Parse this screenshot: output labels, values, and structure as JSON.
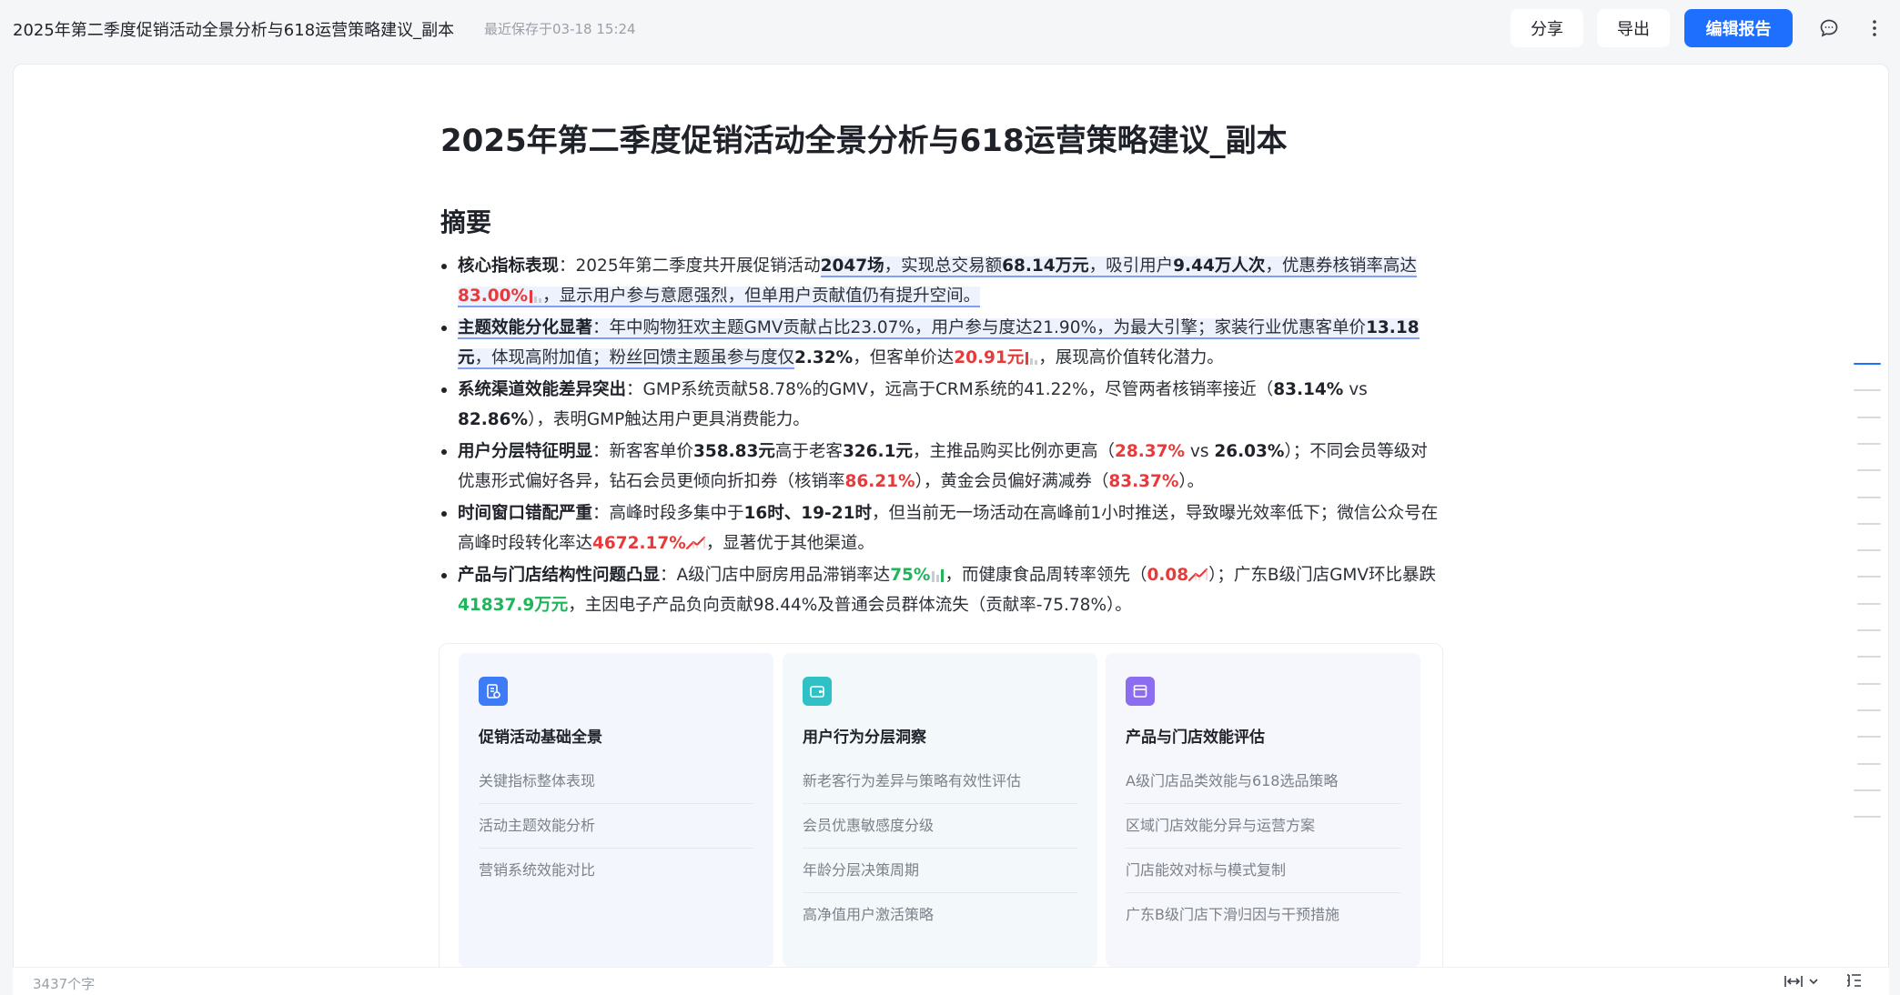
{
  "header": {
    "doc_title": "2025年第二季度促销活动全景分析与618运营策略建议_副本",
    "save_time": "最近保存于03-18 15:24",
    "share_label": "分享",
    "export_label": "导出",
    "edit_label": "编辑报告",
    "icons": [
      "comment-icon",
      "more-icon"
    ]
  },
  "document": {
    "title": "2025年第二季度促销活动全景分析与618运营策略建议_副本",
    "section_title": "摘要",
    "bullets": [
      {
        "label": "核心指标表现",
        "parts": [
          "：2025年第二季度共开展促销活动",
          "2047场",
          "，实现总交易额",
          "68.14万元",
          "，吸引用户",
          "9.44万人次",
          "，优惠券核销率高达",
          "83.00%",
          "，显示用户参与意愿强烈，但单用户贡献值仍有提升空间。"
        ]
      },
      {
        "label": "主题效能分化显著",
        "parts": [
          "：年中购物狂欢主题GMV贡献占比23.07%，用户参与度达21.90%，为最大引擎；家装行业优惠客单价",
          "13.18元",
          "，体现高附加值；粉丝回馈主题虽参与度仅",
          "2.32%",
          "，但客单价达",
          "20.91元",
          "，展现高价值转化潜力。"
        ]
      },
      {
        "label": "系统渠道效能差异突出",
        "parts": [
          "：GMP系统贡献58.78%的GMV，远高于CRM系统的41.22%，尽管两者核销率接近（",
          "83.14%",
          " vs ",
          "82.86%",
          "），表明GMP触达用户更具消费能力。"
        ]
      },
      {
        "label": "用户分层特征明显",
        "parts": [
          "：新客客单价",
          "358.83元",
          "高于老客",
          "326.1元",
          "，主推品购买比例亦更高（",
          "28.37%",
          " vs ",
          "26.03%",
          "）；不同会员等级对优惠形式偏好各异，钻石会员更倾向折扣券（核销率",
          "86.21%",
          "），黄金会员偏好满减券（",
          "83.37%",
          "）。"
        ]
      },
      {
        "label": "时间窗口错配严重",
        "parts": [
          "：高峰时段多集中于",
          "16时、19-21时",
          "，但当前无一场活动在高峰前1小时推送，导致曝光效率低下；微信公众号在高峰时段转化率达",
          "4672.17%",
          "，显著优于其他渠道。"
        ]
      },
      {
        "label": "产品与门店结构性问题凸显",
        "parts": [
          "：A级门店中厨房用品滞销率达",
          "75%",
          "，而健康食品周转率领先（",
          "0.08",
          "）；广东B级门店GMV环比暴跌",
          "41837.9万元",
          "，主因电子产品负向贡献98.44%及普通会员群体流失（贡献率-75.78%）。"
        ]
      }
    ],
    "cards": [
      {
        "icon": "document-icon",
        "title": "促销活动基础全景",
        "items": [
          "关键指标整体表现",
          "活动主题效能分析",
          "营销系统效能对比"
        ]
      },
      {
        "icon": "wallet-icon",
        "title": "用户行为分层洞察",
        "items": [
          "新老客行为差异与策略有效性评估",
          "会员优惠敏感度分级",
          "年龄分层决策周期",
          "高净值用户激活策略"
        ]
      },
      {
        "icon": "window-icon",
        "title": "产品与门店效能评估",
        "items": [
          "A级门店品类效能与618选品策略",
          "区域门店效能分异与运营方案",
          "门店能效对标与模式复制",
          "广东B级门店下滑归因与干预措施"
        ]
      }
    ]
  },
  "statusbar": {
    "word_count": "3437个字",
    "icons": [
      "fit-width-icon",
      "chevron-down-icon",
      "outline-icon"
    ]
  },
  "colors": {
    "accent": "#1f6fff",
    "red_value": "#e83a3a",
    "green_value": "#1fb55a",
    "highlight_bg": "#edf2fd",
    "highlight_line": "#7f9ff3"
  }
}
